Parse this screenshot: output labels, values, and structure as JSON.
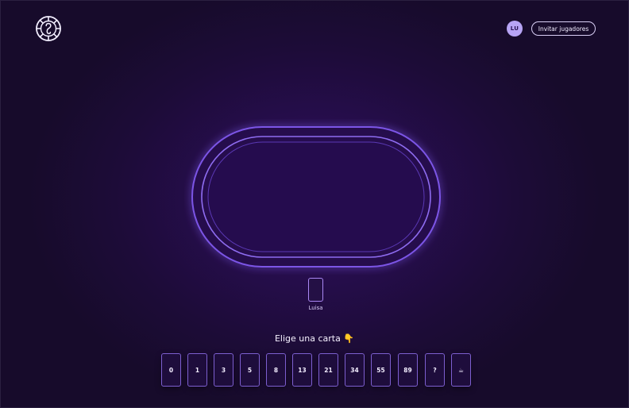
{
  "header": {
    "avatar_initials": "LU",
    "invite_label": "Invitar jugadores"
  },
  "player": {
    "name": "Luisa"
  },
  "prompt": "Elige una carta 👇",
  "cards": [
    "0",
    "1",
    "3",
    "5",
    "8",
    "13",
    "21",
    "34",
    "55",
    "89",
    "?",
    "☕"
  ],
  "colors": {
    "background": "#1d0c38",
    "table_glow": "#6a3cd8",
    "card_border": "#7d5fd0",
    "avatar": "#b7a4f5"
  },
  "icons": {
    "logo": "poker-chip-logo-icon"
  }
}
